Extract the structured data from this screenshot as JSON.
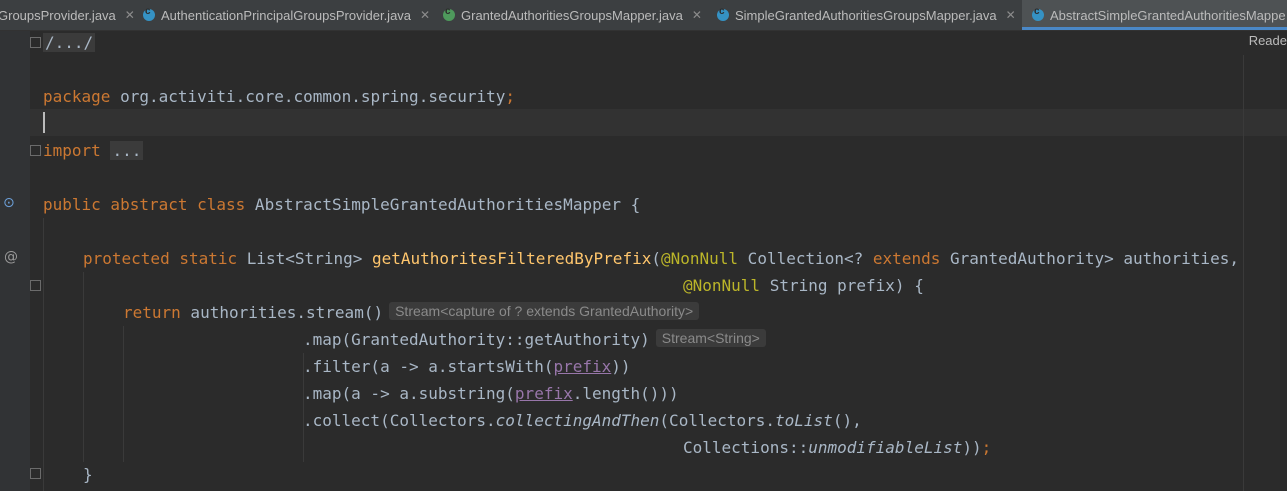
{
  "tabs": [
    {
      "label": "GroupsProvider.java",
      "icon": "class-icon",
      "active": false
    },
    {
      "label": "AuthenticationPrincipalGroupsProvider.java",
      "icon": "class-icon",
      "active": false
    },
    {
      "label": "GrantedAuthoritiesGroupsMapper.java",
      "icon": "interface-icon",
      "active": false
    },
    {
      "label": "SimpleGrantedAuthoritiesGroupsMapper.java",
      "icon": "class-icon",
      "active": false
    },
    {
      "label": "AbstractSimpleGrantedAuthoritiesMappe",
      "icon": "abstract-class-icon",
      "active": true
    }
  ],
  "tab_close_glyph": "✕",
  "reader_mode_label": "Reade",
  "colors": {
    "keyword": "#cc7832",
    "annotation": "#bbb529",
    "function": "#ffc66d",
    "text": "#a9b7c6",
    "param": "#9876aa",
    "background": "#2b2b2b"
  },
  "code": {
    "l1": "/.../",
    "l3_kw": "package",
    "l3_text": " org.activiti.core.common.spring.security",
    "l3_semi": ";",
    "l5_kw": "import",
    "l5_fold": "...",
    "l7_kw": "public abstract class",
    "l7_text": " AbstractSimpleGrantedAuthoritiesMapper {",
    "l9_kw": "protected static",
    "l9_type": " List<String> ",
    "l9_fn": "getAuthoritesFilteredByPrefix",
    "l9_paren": "(",
    "l9_an": "@NonNull",
    "l9_t1": " Collection<? ",
    "l9_kw2": "extends",
    "l9_t2": " GrantedAuthority> authorities,",
    "l10_an": "@NonNull",
    "l10_text": " String prefix) {",
    "l11_kw": "return",
    "l11_text": " authorities.stream()",
    "l11_hint": "Stream<capture of ? extends GrantedAuthority>",
    "l12_text": ".map(GrantedAuthority::getAuthority)",
    "l12_hint": "Stream<String>",
    "l13_a": ".filter(a -> a.startsWith(",
    "l13_p": "prefix",
    "l13_b": "))",
    "l14_a": ".map(a -> a.substring(",
    "l14_p": "prefix",
    "l14_b": ".length()))",
    "l15_a": ".collect(Collectors.",
    "l15_i1": "collectingAndThen",
    "l15_b": "(Collectors.",
    "l15_i2": "toList",
    "l15_c": "(),",
    "l16_a": "Collections::",
    "l16_i": "unmodifiableList",
    "l16_b": "))",
    "l16_semi": ";",
    "l17": "}"
  }
}
